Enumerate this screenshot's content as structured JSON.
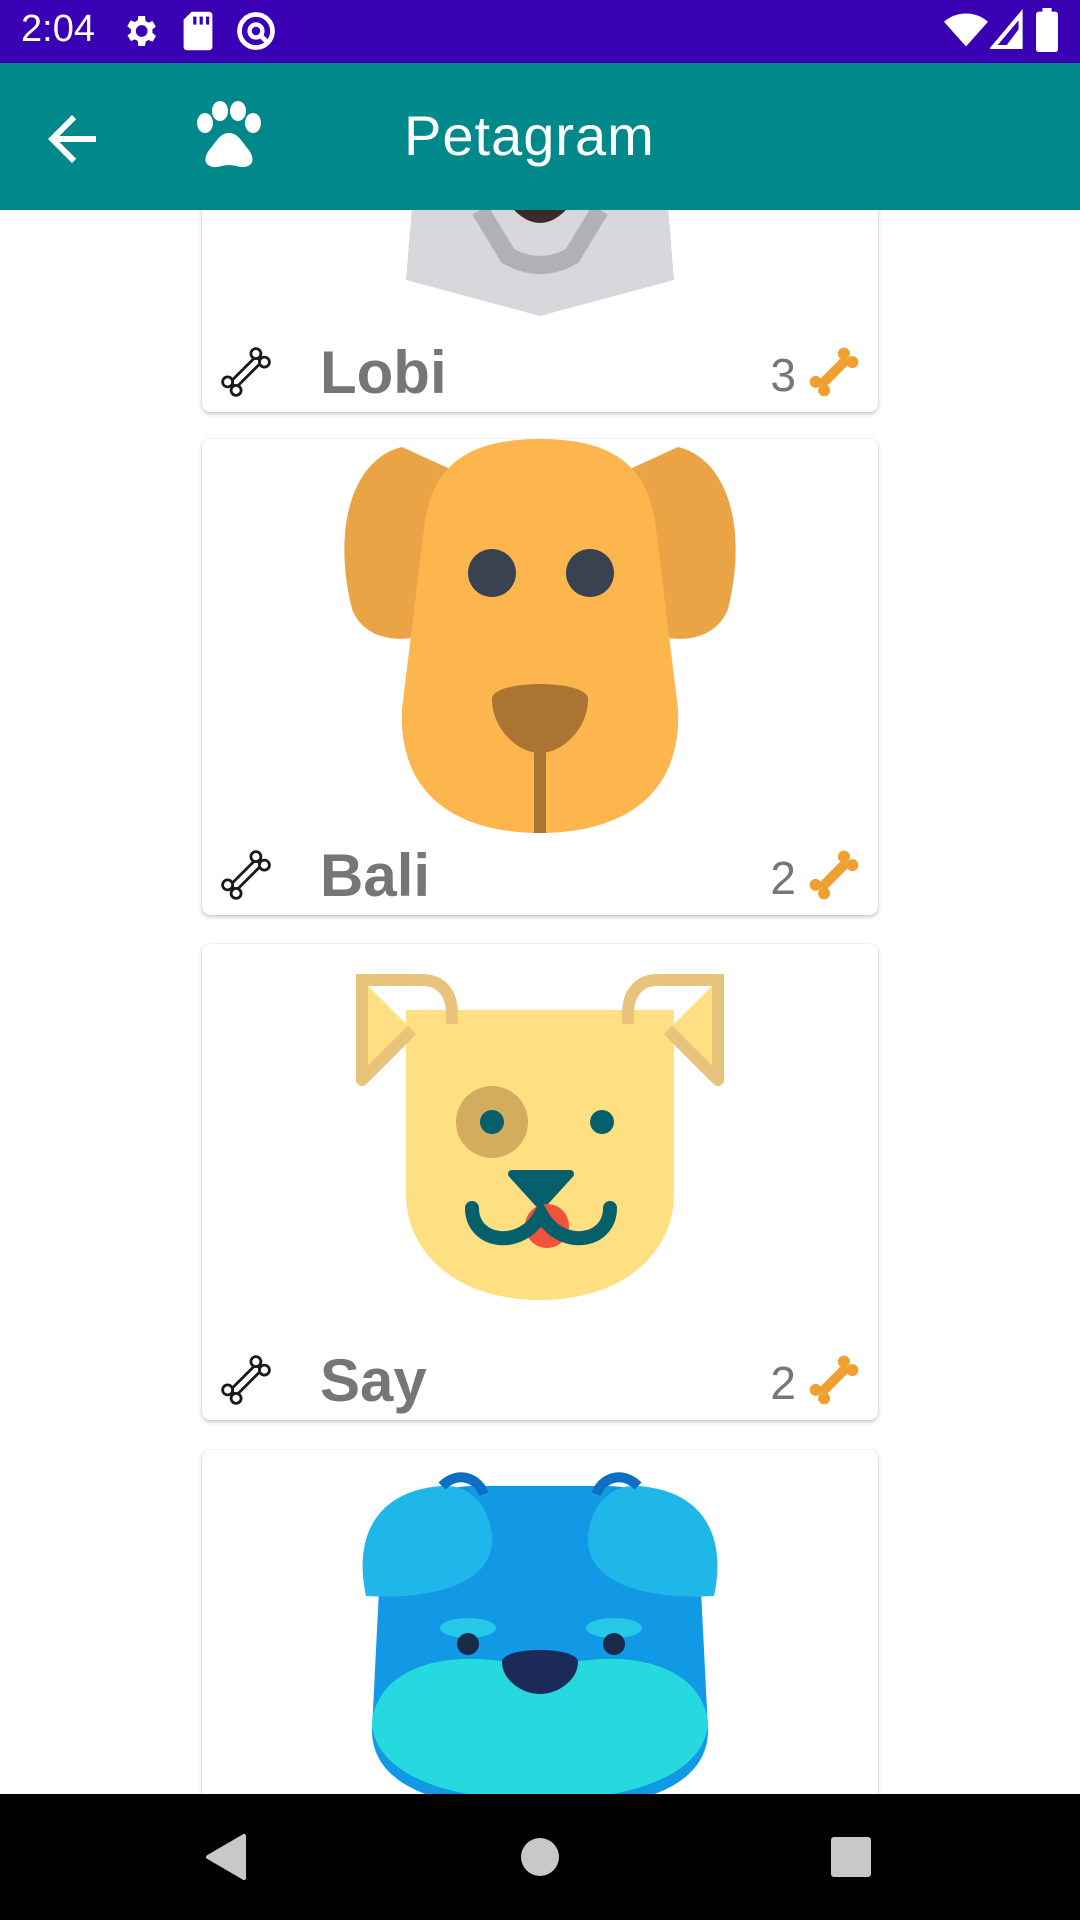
{
  "status_bar": {
    "time": "2:04",
    "icons": [
      "settings-icon",
      "sd-card-icon",
      "no-sim-icon",
      "wifi-icon",
      "signal-icon",
      "battery-icon"
    ],
    "color": "#3a00b3"
  },
  "app_bar": {
    "title": "Petagram",
    "back_icon": "arrow-back-icon",
    "logo_icon": "paw-icon",
    "color": "#00888a"
  },
  "pets": [
    {
      "name": "Lobi",
      "likes": "3",
      "image": "gray-dog-icon"
    },
    {
      "name": "Bali",
      "likes": "2",
      "image": "orange-dog-icon"
    },
    {
      "name": "Say",
      "likes": "2",
      "image": "yellow-dog-icon"
    },
    {
      "name": "",
      "likes": "",
      "image": "blue-bulldog-icon"
    }
  ],
  "colors": {
    "text_gray": "#767676",
    "bone_orange": "#f0a030"
  },
  "nav_bar": {
    "icons": [
      "back-triangle-icon",
      "home-circle-icon",
      "recents-square-icon"
    ]
  }
}
